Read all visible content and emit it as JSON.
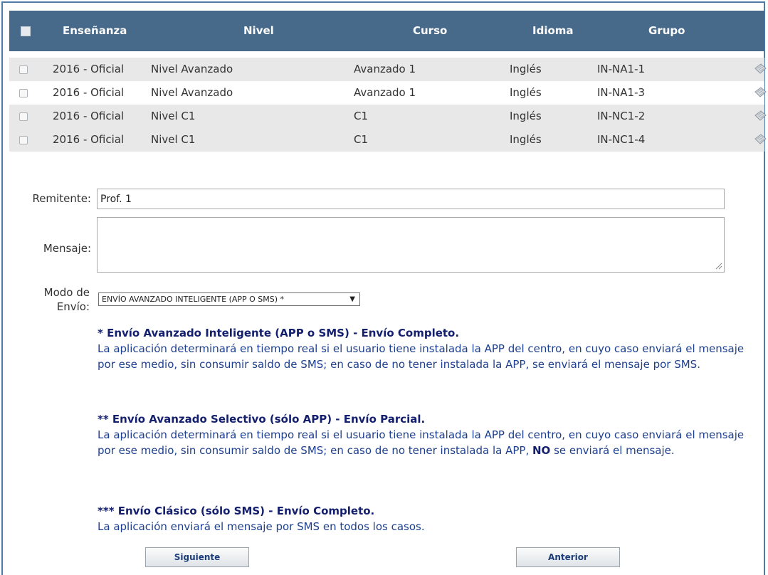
{
  "table": {
    "headers": [
      "Enseñanza",
      "Nivel",
      "Curso",
      "Idioma",
      "Grupo"
    ],
    "rows": [
      {
        "ensenanza": "2016 - Oficial",
        "nivel": "Nivel Avanzado",
        "curso": "Avanzado 1",
        "idioma": "Inglés",
        "grupo": "IN-NA1-1"
      },
      {
        "ensenanza": "2016 - Oficial",
        "nivel": "Nivel Avanzado",
        "curso": "Avanzado 1",
        "idioma": "Inglés",
        "grupo": "IN-NA1-3"
      },
      {
        "ensenanza": "2016 - Oficial",
        "nivel": "Nivel C1",
        "curso": "C1",
        "idioma": "Inglés",
        "grupo": "IN-NC1-2"
      },
      {
        "ensenanza": "2016 - Oficial",
        "nivel": "Nivel C1",
        "curso": "C1",
        "idioma": "Inglés",
        "grupo": "IN-NC1-4"
      }
    ],
    "row_icon": "pencil-edit-icon"
  },
  "form": {
    "remitente_label": "Remitente:",
    "remitente_value": "Prof. 1",
    "mensaje_label": "Mensaje:",
    "mensaje_value": "",
    "modo_label_line1": "Modo de",
    "modo_label_line2": "Envío:",
    "modo_selected": "ENVÍO AVANZADO INTELIGENTE (APP O SMS) *",
    "modo_arrow": "▼"
  },
  "info": [
    {
      "title": "* Envío Avanzado Inteligente (APP o SMS) - Envío Completo.",
      "text_before": "La aplicación determinará en tiempo real si el usuario tiene instalada la APP del centro, en cuyo caso enviará el mensaje por ese medio, sin consumir saldo de SMS; en caso de no tener instalada la APP, se enviará el mensaje por SMS.",
      "strong": "",
      "text_after": ""
    },
    {
      "title": "** Envío Avanzado Selectivo (sólo APP) - Envío Parcial.",
      "text_before": "La aplicación determinará en tiempo real si el usuario tiene instalada la APP del centro, en cuyo caso enviará el mensaje por ese medio, sin consumir saldo de SMS; en caso de no tener instalada la APP, ",
      "strong": "NO",
      "text_after": " se enviará el mensaje."
    },
    {
      "title": "*** Envío Clásico (sólo SMS) - Envío Completo.",
      "text_before": "La aplicación enviará el mensaje por SMS en todos los casos.",
      "strong": "",
      "text_after": ""
    }
  ],
  "buttons": {
    "next": "Siguiente",
    "prev": "Anterior"
  },
  "colors": {
    "header_bg": "#476a8b",
    "row_shade": "#e8e8e8",
    "info_text": "#1d3f8f",
    "info_title": "#14206e"
  }
}
